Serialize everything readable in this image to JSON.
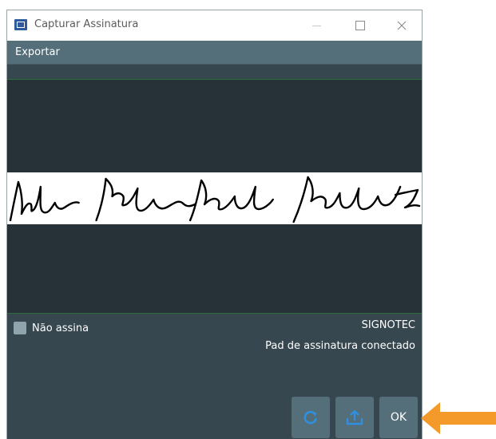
{
  "window": {
    "title": "Capturar Assinatura",
    "controls": {
      "minimize": "minimize-icon",
      "maximize": "maximize-icon",
      "close": "close-icon"
    }
  },
  "menu": {
    "items": [
      {
        "label": "Exportar"
      }
    ]
  },
  "signature": {
    "present": true
  },
  "options": {
    "not_signing_label": "Não assina",
    "not_signing_checked": false
  },
  "device": {
    "name": "SIGNOTEC",
    "status": "Pad de assinatura conectado"
  },
  "actions": {
    "refresh_icon": "refresh-icon",
    "upload_icon": "upload-icon",
    "ok_label": "OK"
  },
  "colors": {
    "window_bg": "#37474f",
    "canvas_bg": "#263238",
    "menu_bg": "#546e7a",
    "button_bg": "#546e7a",
    "accent_arrow": "#f39a2b",
    "icon_blue": "#2f8fe0"
  }
}
